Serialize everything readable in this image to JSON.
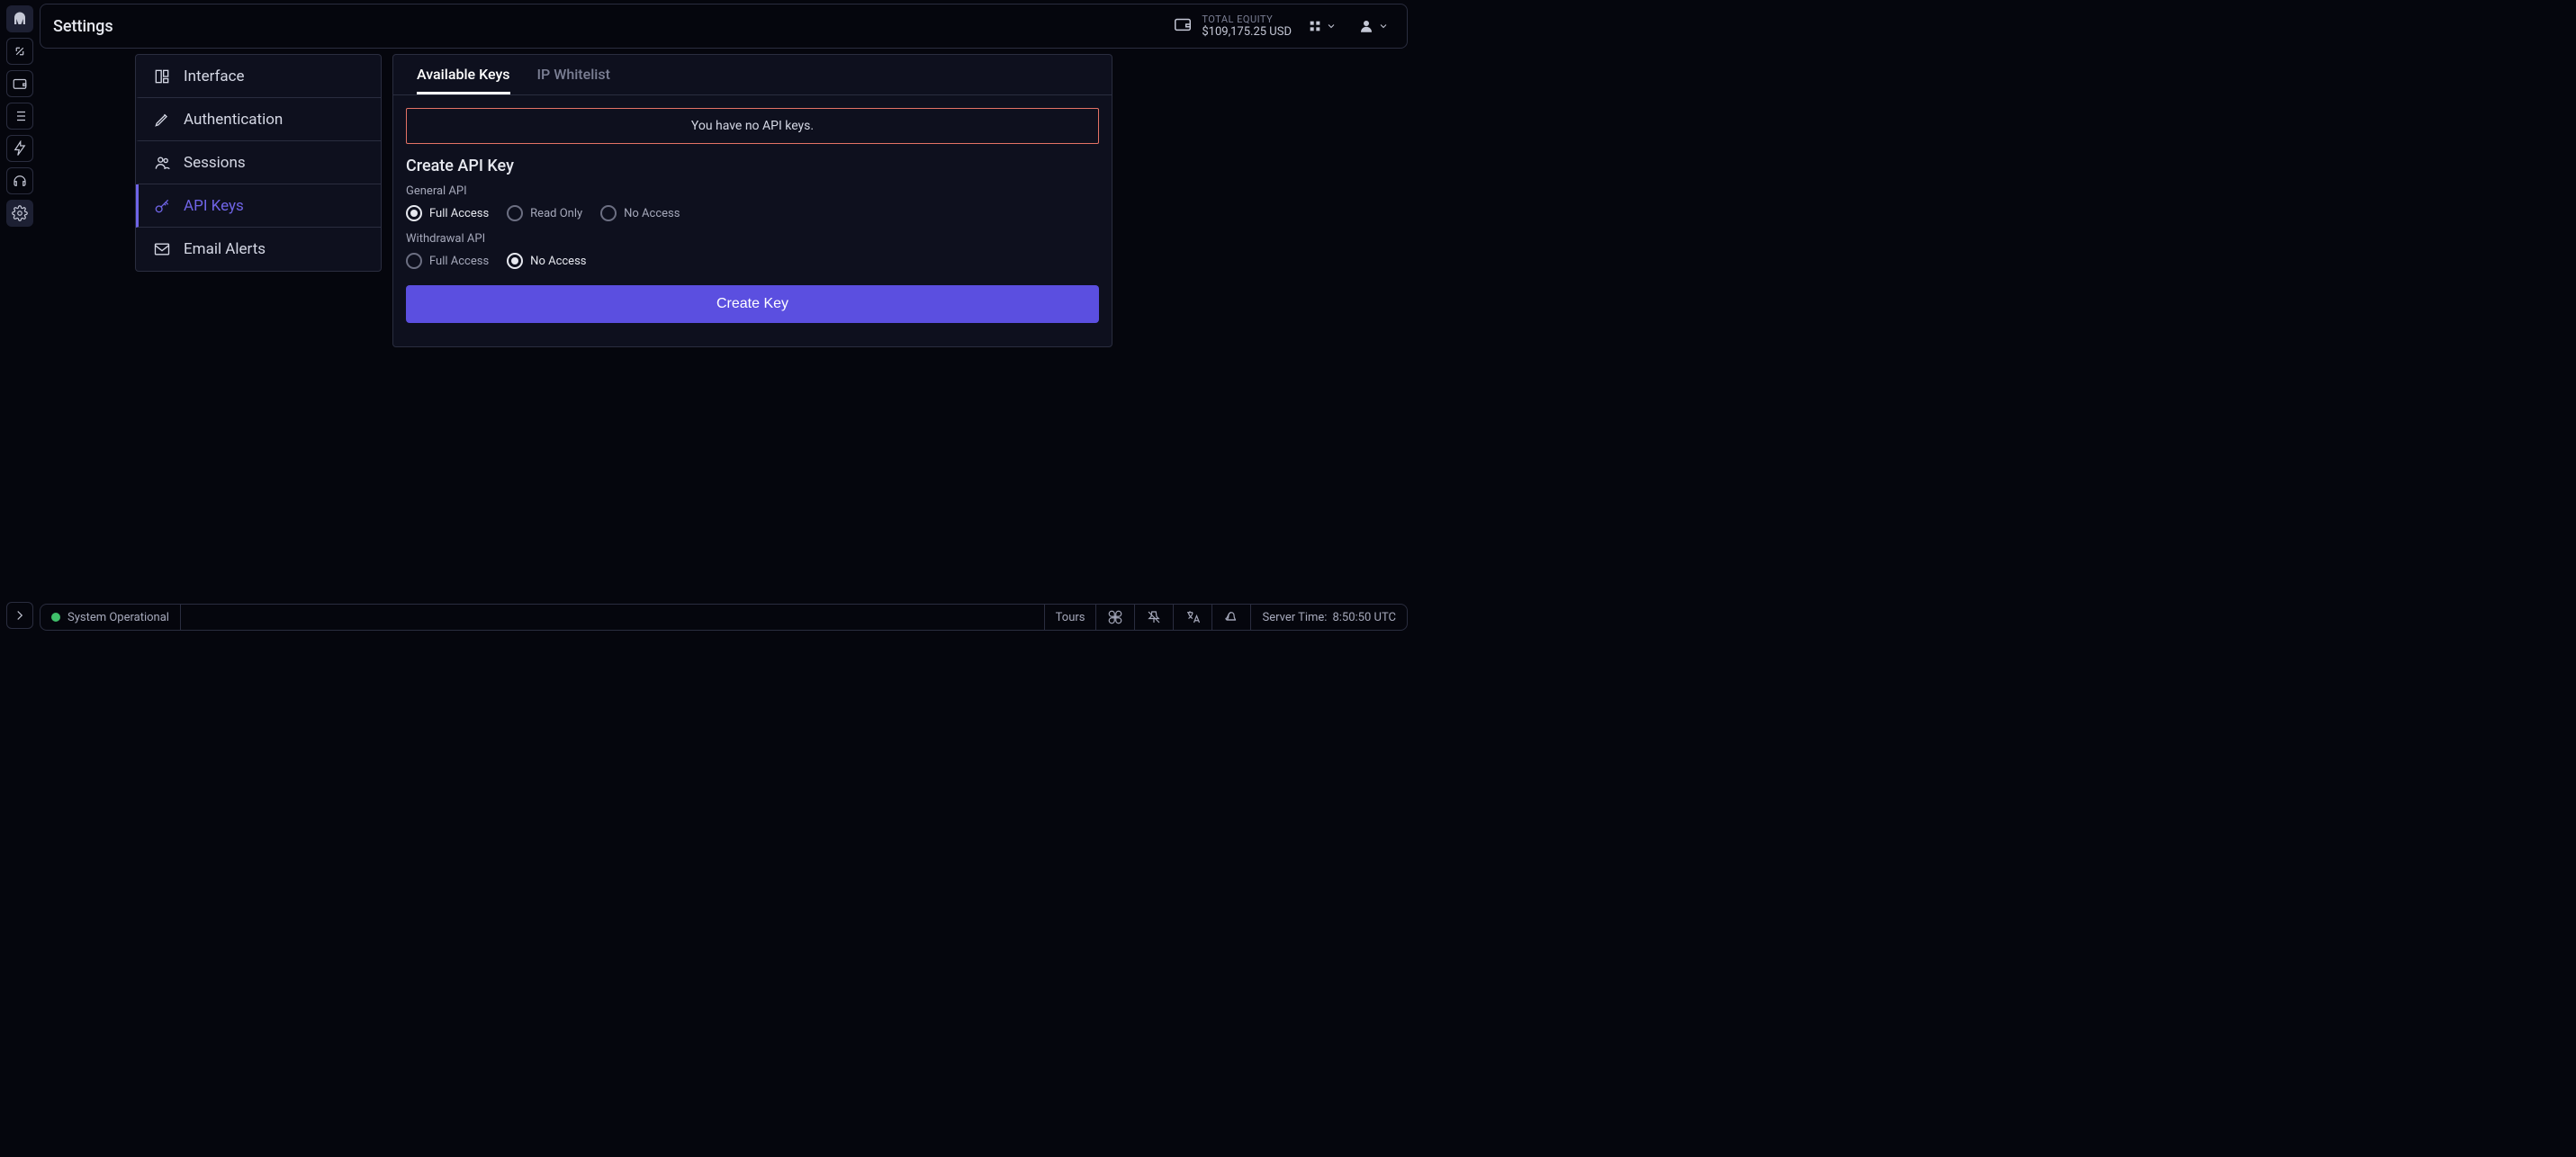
{
  "header": {
    "title": "Settings",
    "equity_label": "TOTAL EQUITY",
    "equity_value": "$109,175.25 USD"
  },
  "sidebar": {
    "items": [
      {
        "label": "Interface"
      },
      {
        "label": "Authentication"
      },
      {
        "label": "Sessions"
      },
      {
        "label": "API Keys"
      },
      {
        "label": "Email Alerts"
      }
    ]
  },
  "tabs": {
    "available": "Available Keys",
    "whitelist": "IP Whitelist"
  },
  "alert": "You have no API keys.",
  "form": {
    "title": "Create API Key",
    "general_label": "General API",
    "withdrawal_label": "Withdrawal API",
    "options": {
      "full": "Full Access",
      "read": "Read Only",
      "none": "No Access"
    },
    "submit": "Create Key"
  },
  "footer": {
    "status": "System Operational",
    "tours": "Tours",
    "server_time_label": "Server Time: ",
    "server_time": "8:50:50 UTC"
  }
}
